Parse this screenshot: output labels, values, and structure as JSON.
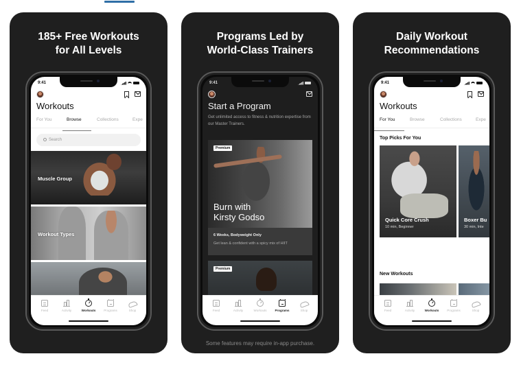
{
  "colors": {
    "card_background": "#1f1f1f",
    "top_indicator": "#2e6ea6",
    "tab_active": "#111111",
    "tab_inactive": "#a9a9a9"
  },
  "cards": [
    {
      "title_line1": "185+ Free Workouts",
      "title_line2": "for All Levels",
      "screen": {
        "time": "9:41",
        "title": "Workouts",
        "header_icons": [
          "bookmark-icon",
          "mail-icon"
        ],
        "tabs": [
          {
            "label": "For You",
            "active": false
          },
          {
            "label": "Browse",
            "active": true
          },
          {
            "label": "Collections",
            "active": false
          },
          {
            "label": "Expe",
            "active": false
          }
        ],
        "search_placeholder": "Search",
        "browse_tiles": [
          {
            "label": "Muscle Group"
          },
          {
            "label": "Workout Types"
          },
          {
            "label": ""
          }
        ]
      }
    },
    {
      "title_line1": "Programs Led by",
      "title_line2": "World-Class Trainers",
      "footer": "Some features may require in-app purchase.",
      "screen": {
        "time": "9:41",
        "title": "Start a Program",
        "description": "Get unlimited access to fitness & nutrition expertise from our Master Trainers.",
        "programs": [
          {
            "badge": "Premium",
            "name_line1": "Burn with",
            "name_line2": "Kirsty Godso",
            "meta": "6 Weeks, Bodyweight Only",
            "subtitle": "Get lean & confident with a spicy mix of HIIT"
          },
          {
            "badge": "Premium"
          }
        ]
      }
    },
    {
      "title_line1": "Daily Workout",
      "title_line2": "Recommendations",
      "screen": {
        "time": "9:41",
        "title": "Workouts",
        "tabs": [
          {
            "label": "For You",
            "active": true
          },
          {
            "label": "Browse",
            "active": false
          },
          {
            "label": "Collections",
            "active": false
          },
          {
            "label": "Expe",
            "active": false
          }
        ],
        "top_picks_title": "Top Picks For You",
        "top_picks": [
          {
            "name": "Quick Core Crush",
            "meta": "10 min, Beginner"
          },
          {
            "name": "Boxer Bu",
            "meta": "30 min, Inte"
          }
        ],
        "new_workouts_title": "New Workouts"
      }
    }
  ],
  "tabbar": {
    "items": [
      {
        "label": "Feed",
        "icon": "feed-icon"
      },
      {
        "label": "Activity",
        "icon": "activity-icon"
      },
      {
        "label": "Workouts",
        "icon": "stopwatch-icon"
      },
      {
        "label": "Programs",
        "icon": "calendar-icon"
      },
      {
        "label": "Shop",
        "icon": "shoe-icon"
      }
    ]
  }
}
